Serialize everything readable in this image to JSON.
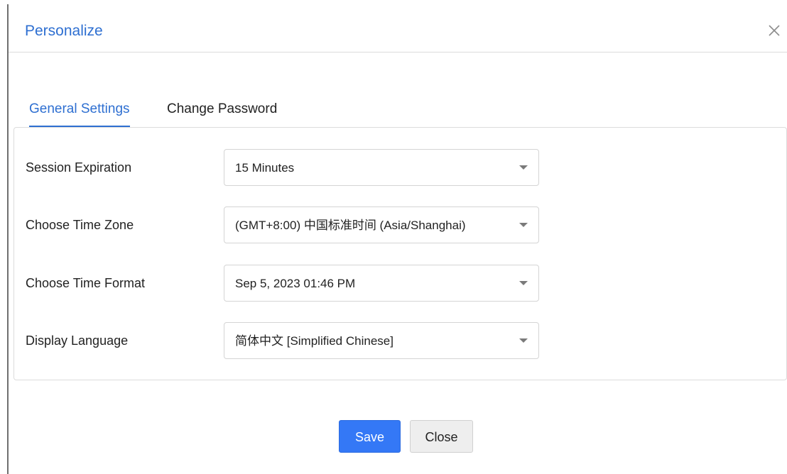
{
  "dialog": {
    "title": "Personalize",
    "close_icon": "close-icon"
  },
  "tabs": [
    {
      "label": "General Settings",
      "active": true
    },
    {
      "label": "Change Password",
      "active": false
    }
  ],
  "settings": [
    {
      "label": "Session Expiration",
      "value": "15 Minutes"
    },
    {
      "label": "Choose Time Zone",
      "value": "(GMT+8:00) 中国标准时间 (Asia/Shanghai)"
    },
    {
      "label": "Choose Time Format",
      "value": "Sep 5, 2023 01:46 PM"
    },
    {
      "label": "Display Language",
      "value": "简体中文 [Simplified Chinese]"
    }
  ],
  "footer": {
    "save_label": "Save",
    "close_label": "Close"
  },
  "colors": {
    "accent": "#2e6fd1",
    "primary_button": "#3478f6",
    "secondary_button": "#eeeeee"
  }
}
